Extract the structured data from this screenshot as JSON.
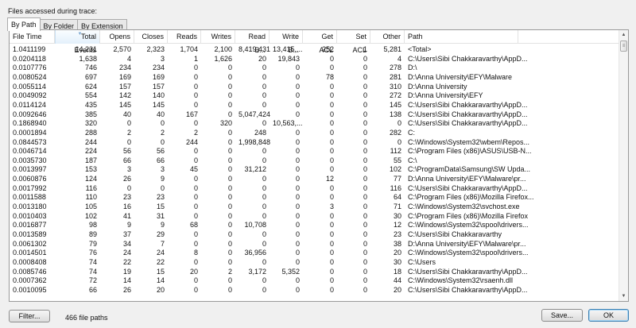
{
  "title": "Files accessed during trace:",
  "tabs": [
    "By Path",
    "By Folder",
    "By Extension"
  ],
  "columns": [
    "File Time",
    "Total Events",
    "Opens",
    "Closes",
    "Reads",
    "Writes",
    "Read B...",
    "Write B...",
    "Get ACL",
    "Set ACL",
    "Other",
    "Path"
  ],
  "rows": [
    [
      "1.0411199",
      "14,231",
      "2,570",
      "2,323",
      "1,704",
      "2,100",
      "8,419,431",
      "13,415,...",
      "252",
      "1",
      "5,281",
      "<Total>"
    ],
    [
      "0.0204118",
      "1,638",
      "4",
      "3",
      "1",
      "1,626",
      "20",
      "19,843",
      "0",
      "0",
      "4",
      "C:\\Users\\Sibi Chakkaravarthy\\AppD..."
    ],
    [
      "0.0107776",
      "746",
      "234",
      "234",
      "0",
      "0",
      "0",
      "0",
      "0",
      "0",
      "278",
      "D:\\"
    ],
    [
      "0.0080524",
      "697",
      "169",
      "169",
      "0",
      "0",
      "0",
      "0",
      "78",
      "0",
      "281",
      "D:\\Anna University\\EFY\\Malware"
    ],
    [
      "0.0055114",
      "624",
      "157",
      "157",
      "0",
      "0",
      "0",
      "0",
      "0",
      "0",
      "310",
      "D:\\Anna University"
    ],
    [
      "0.0049092",
      "554",
      "142",
      "140",
      "0",
      "0",
      "0",
      "0",
      "0",
      "0",
      "272",
      "D:\\Anna University\\EFY"
    ],
    [
      "0.0114124",
      "435",
      "145",
      "145",
      "0",
      "0",
      "0",
      "0",
      "0",
      "0",
      "145",
      "C:\\Users\\Sibi Chakkaravarthy\\AppD..."
    ],
    [
      "0.0092646",
      "385",
      "40",
      "40",
      "167",
      "0",
      "5,047,424",
      "0",
      "0",
      "0",
      "138",
      "C:\\Users\\Sibi Chakkaravarthy\\AppD..."
    ],
    [
      "0.1868940",
      "320",
      "0",
      "0",
      "0",
      "320",
      "0",
      "10,563,...",
      "0",
      "0",
      "0",
      "C:\\Users\\Sibi Chakkaravarthy\\AppD..."
    ],
    [
      "0.0001894",
      "288",
      "2",
      "2",
      "2",
      "0",
      "248",
      "0",
      "0",
      "0",
      "282",
      "C:"
    ],
    [
      "0.0844573",
      "244",
      "0",
      "0",
      "244",
      "0",
      "1,998,848",
      "0",
      "0",
      "0",
      "0",
      "C:\\Windows\\System32\\wbem\\Repos..."
    ],
    [
      "0.0046714",
      "224",
      "56",
      "56",
      "0",
      "0",
      "0",
      "0",
      "0",
      "0",
      "112",
      "C:\\Program Files (x86)\\ASUS\\USB-N..."
    ],
    [
      "0.0035730",
      "187",
      "66",
      "66",
      "0",
      "0",
      "0",
      "0",
      "0",
      "0",
      "55",
      "C:\\"
    ],
    [
      "0.0013997",
      "153",
      "3",
      "3",
      "45",
      "0",
      "31,212",
      "0",
      "0",
      "0",
      "102",
      "C:\\ProgramData\\Samsung\\SW Upda..."
    ],
    [
      "0.0060876",
      "124",
      "26",
      "9",
      "0",
      "0",
      "0",
      "0",
      "12",
      "0",
      "77",
      "D:\\Anna University\\EFY\\Malware\\pr..."
    ],
    [
      "0.0017992",
      "116",
      "0",
      "0",
      "0",
      "0",
      "0",
      "0",
      "0",
      "0",
      "116",
      "C:\\Users\\Sibi Chakkaravarthy\\AppD..."
    ],
    [
      "0.0011588",
      "110",
      "23",
      "23",
      "0",
      "0",
      "0",
      "0",
      "0",
      "0",
      "64",
      "C:\\Program Files (x86)\\Mozilla Firefox..."
    ],
    [
      "0.0013180",
      "105",
      "16",
      "15",
      "0",
      "0",
      "0",
      "0",
      "3",
      "0",
      "71",
      "C:\\Windows\\System32\\svchost.exe"
    ],
    [
      "0.0010403",
      "102",
      "41",
      "31",
      "0",
      "0",
      "0",
      "0",
      "0",
      "0",
      "30",
      "C:\\Program Files (x86)\\Mozilla Firefox"
    ],
    [
      "0.0016877",
      "98",
      "9",
      "9",
      "68",
      "0",
      "10,708",
      "0",
      "0",
      "0",
      "12",
      "C:\\Windows\\System32\\spool\\drivers..."
    ],
    [
      "0.0013589",
      "89",
      "37",
      "29",
      "0",
      "0",
      "0",
      "0",
      "0",
      "0",
      "23",
      "C:\\Users\\Sibi Chakkaravarthy"
    ],
    [
      "0.0061302",
      "79",
      "34",
      "7",
      "0",
      "0",
      "0",
      "0",
      "0",
      "0",
      "38",
      "D:\\Anna University\\EFY\\Malware\\pr..."
    ],
    [
      "0.0014501",
      "76",
      "24",
      "24",
      "8",
      "0",
      "36,956",
      "0",
      "0",
      "0",
      "20",
      "C:\\Windows\\System32\\spool\\drivers..."
    ],
    [
      "0.0008408",
      "74",
      "22",
      "22",
      "0",
      "0",
      "0",
      "0",
      "0",
      "0",
      "30",
      "C:\\Users"
    ],
    [
      "0.0085746",
      "74",
      "19",
      "15",
      "20",
      "2",
      "3,172",
      "5,352",
      "0",
      "0",
      "18",
      "C:\\Users\\Sibi Chakkaravarthy\\AppD..."
    ],
    [
      "0.0007362",
      "72",
      "14",
      "14",
      "0",
      "0",
      "0",
      "0",
      "0",
      "0",
      "44",
      "C:\\Windows\\System32\\rsaenh.dll"
    ],
    [
      "0.0010095",
      "66",
      "26",
      "20",
      "0",
      "0",
      "0",
      "0",
      "0",
      "0",
      "20",
      "C:\\Users\\Sibi Chakkaravarthy\\AppD..."
    ]
  ],
  "footer": {
    "filter_label": "Filter...",
    "count": "466 file paths",
    "save_label": "Save...",
    "ok_label": "OK"
  }
}
